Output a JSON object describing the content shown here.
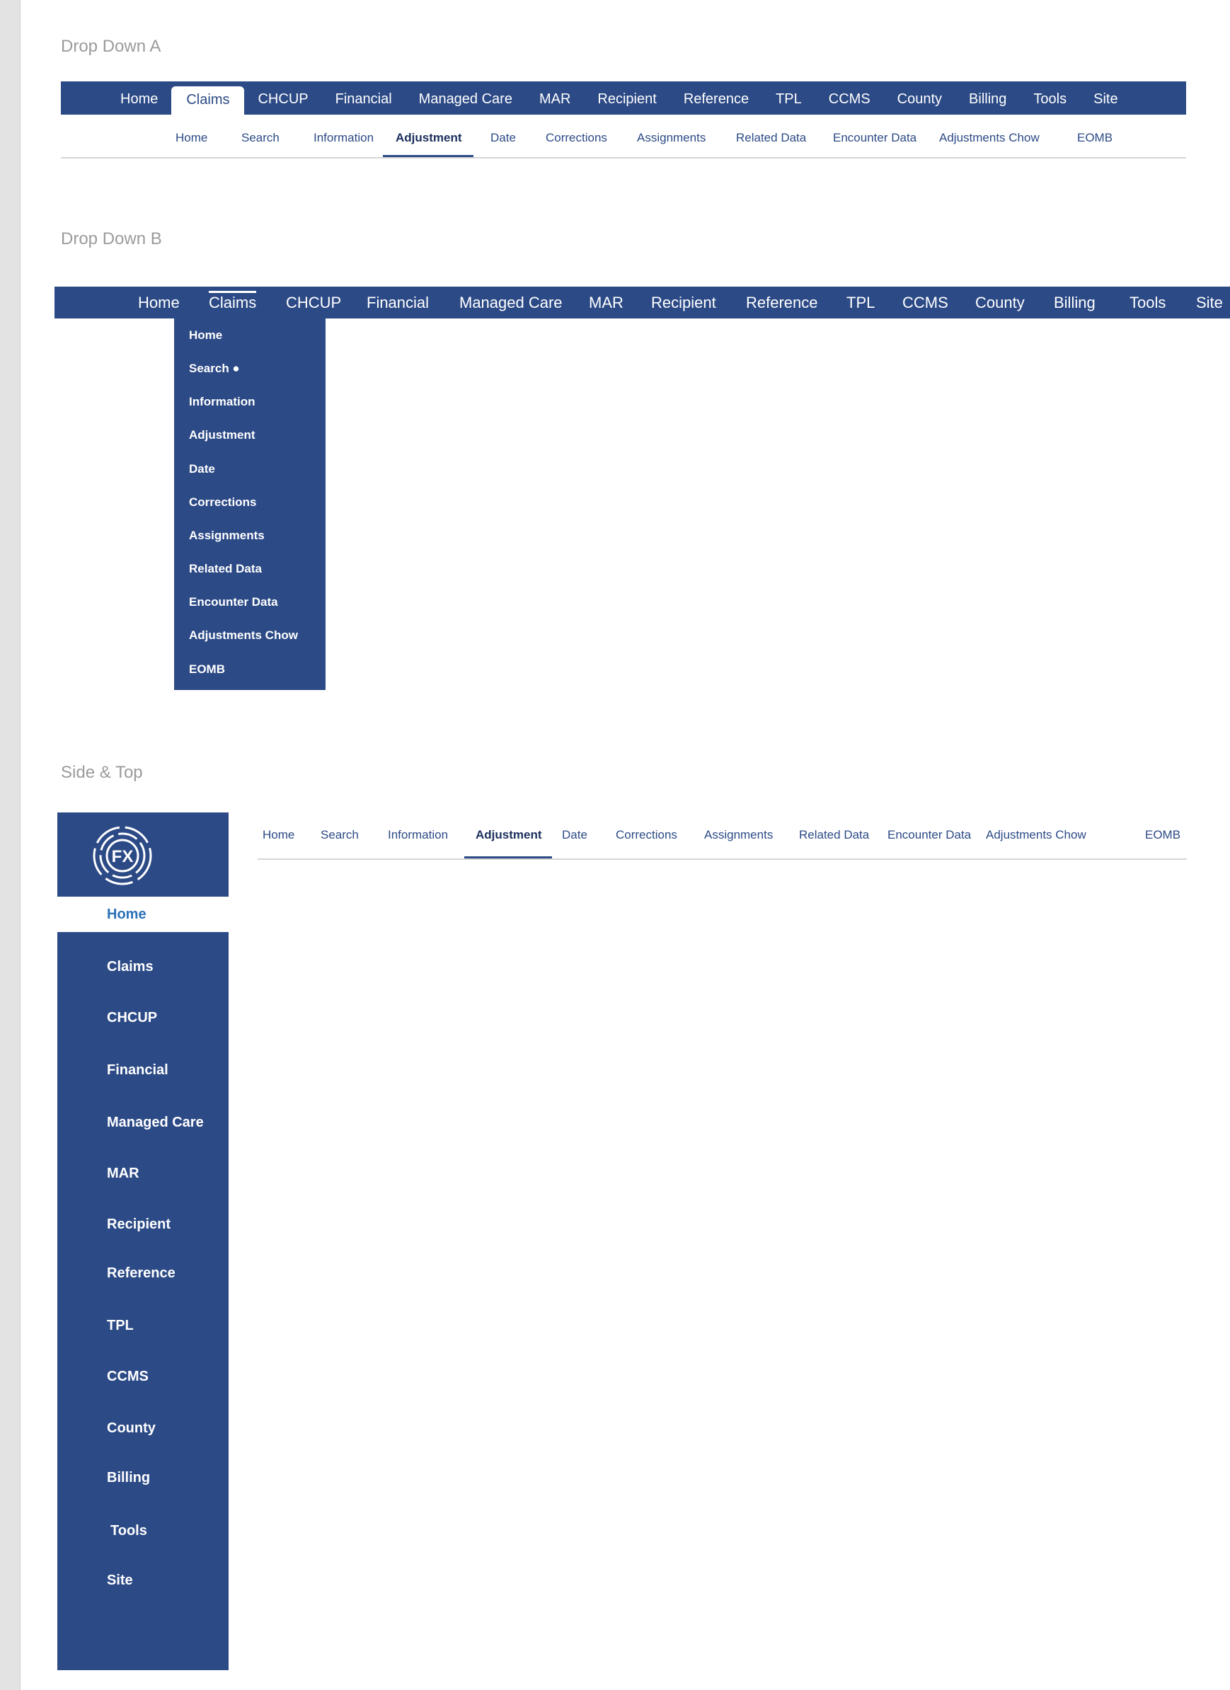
{
  "sections": {
    "dropdown_a": "Drop Down A",
    "dropdown_b": "Drop Down B",
    "side_top": "Side & Top"
  },
  "main_nav": [
    {
      "label": "Home"
    },
    {
      "label": "Claims",
      "active": true
    },
    {
      "label": "CHCUP"
    },
    {
      "label": "Financial"
    },
    {
      "label": "Managed Care"
    },
    {
      "label": "MAR"
    },
    {
      "label": "Recipient"
    },
    {
      "label": "Reference"
    },
    {
      "label": "TPL"
    },
    {
      "label": "CCMS"
    },
    {
      "label": "County"
    },
    {
      "label": "Billing"
    },
    {
      "label": "Tools"
    },
    {
      "label": "Site"
    }
  ],
  "claims_sub_nav": [
    {
      "label": "Home"
    },
    {
      "label": "Search"
    },
    {
      "label": "Information"
    },
    {
      "label": "Adjustment",
      "active": true
    },
    {
      "label": "Date"
    },
    {
      "label": "Corrections"
    },
    {
      "label": "Assignments"
    },
    {
      "label": "Related Data"
    },
    {
      "label": "Encounter Data"
    },
    {
      "label": "Adjustments Chow"
    },
    {
      "label": "EOMB"
    }
  ],
  "dropdown_b_menu": [
    {
      "label": "Home"
    },
    {
      "label": "Search ●"
    },
    {
      "label": "Information"
    },
    {
      "label": "Adjustment"
    },
    {
      "label": "Date"
    },
    {
      "label": "Corrections"
    },
    {
      "label": "Assignments"
    },
    {
      "label": "Related Data"
    },
    {
      "label": "Encounter Data"
    },
    {
      "label": "Adjustments Chow"
    },
    {
      "label": "EOMB"
    }
  ],
  "sidebar": {
    "logo_text": "FX",
    "items": [
      {
        "label": "Home",
        "active": true
      },
      {
        "label": "Claims"
      },
      {
        "label": "CHCUP"
      },
      {
        "label": "Financial"
      },
      {
        "label": "Managed Care"
      },
      {
        "label": "MAR"
      },
      {
        "label": "Recipient"
      },
      {
        "label": "Reference"
      },
      {
        "label": "TPL"
      },
      {
        "label": "CCMS"
      },
      {
        "label": "County"
      },
      {
        "label": "Billing"
      },
      {
        "label": "Tools"
      },
      {
        "label": "Site"
      }
    ]
  },
  "colors": {
    "nav_blue": "#2c4a86",
    "active_text_blue": "#2a71b8",
    "section_title_gray": "#9b9b9b",
    "divider_gray": "#d6d6d6"
  },
  "icons": {
    "logo": "fx-circular-logo-icon"
  }
}
